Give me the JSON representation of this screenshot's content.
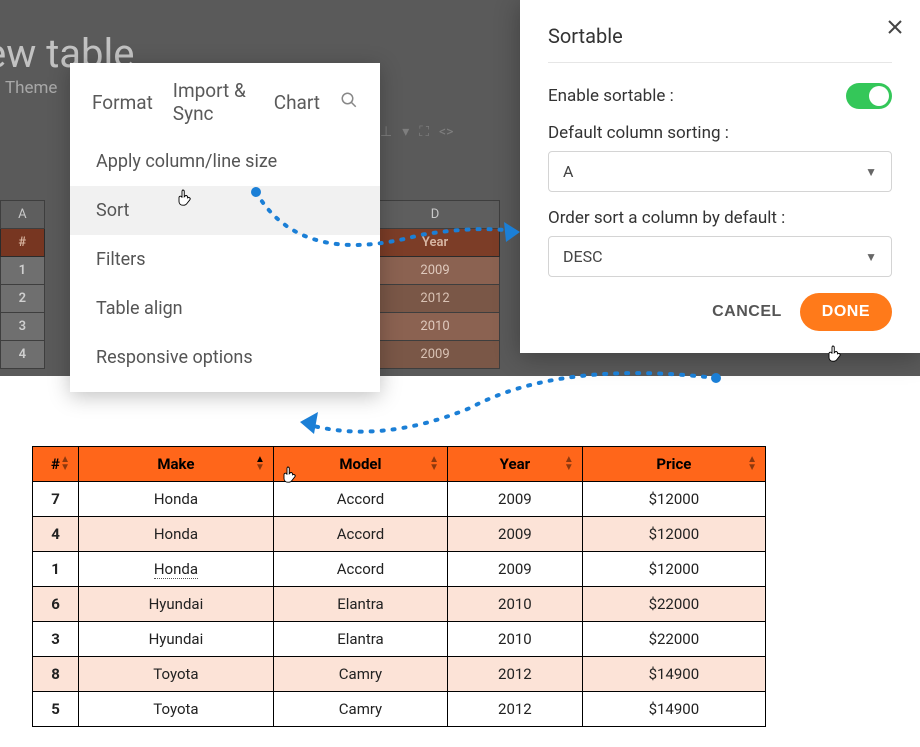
{
  "page_title_partial": "ew table",
  "tabs": {
    "theme": "Theme",
    "format": "Format",
    "import": "Import & Sync",
    "chart": "Chart"
  },
  "dropdown": {
    "items": [
      "Apply column/line size",
      "Sort",
      "Filters",
      "Table align",
      "Responsive options"
    ],
    "highlighted_index": 1
  },
  "background_sheet": {
    "col_letters": [
      "A",
      "D"
    ],
    "header_cells": [
      "#",
      "Year"
    ],
    "rows": [
      {
        "hash": "1",
        "year": "2009"
      },
      {
        "hash": "2",
        "year": "2012"
      },
      {
        "hash": "3",
        "year": "2010"
      },
      {
        "hash": "4",
        "year": "2009"
      }
    ]
  },
  "modal": {
    "title": "Sortable",
    "enable_label": "Enable sortable :",
    "default_col_label": "Default column sorting :",
    "default_col_value": "A",
    "order_label": "Order sort a column by default :",
    "order_value": "DESC",
    "cancel": "CANCEL",
    "done": "DONE"
  },
  "result_table": {
    "headers": [
      "#",
      "Make",
      "Model",
      "Year",
      "Price"
    ],
    "rows": [
      {
        "hash": "7",
        "make": "Honda",
        "model": "Accord",
        "year": "2009",
        "price": "$12000"
      },
      {
        "hash": "4",
        "make": "Honda",
        "model": "Accord",
        "year": "2009",
        "price": "$12000"
      },
      {
        "hash": "1",
        "make": "Honda",
        "model": "Accord",
        "year": "2009",
        "price": "$12000"
      },
      {
        "hash": "6",
        "make": "Hyundai",
        "model": "Elantra",
        "year": "2010",
        "price": "$22000"
      },
      {
        "hash": "3",
        "make": "Hyundai",
        "model": "Elantra",
        "year": "2010",
        "price": "$22000"
      },
      {
        "hash": "8",
        "make": "Toyota",
        "model": "Camry",
        "year": "2012",
        "price": "$14900"
      },
      {
        "hash": "5",
        "make": "Toyota",
        "model": "Camry",
        "year": "2012",
        "price": "$14900"
      }
    ]
  }
}
